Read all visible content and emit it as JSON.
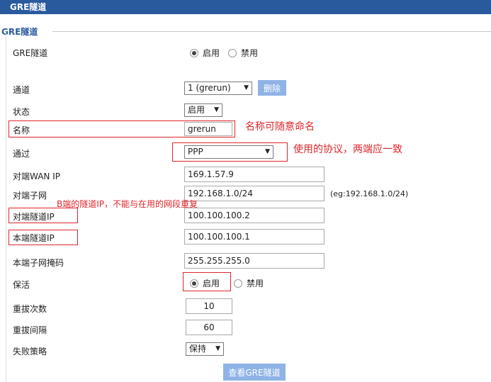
{
  "window": {
    "title": "GRE隧道"
  },
  "section": {
    "title": "GRE隧道"
  },
  "form": {
    "gre_tunnel": {
      "label": "GRE隧道",
      "enable": "启用",
      "disable": "禁用"
    },
    "channel": {
      "label": "通道",
      "value": "1 (grerun)",
      "delete_label": "删除"
    },
    "status": {
      "label": "状态",
      "value": "启用"
    },
    "name": {
      "label": "名称",
      "value": "grerun"
    },
    "via": {
      "label": "通过",
      "value": "PPP"
    },
    "remote_wan_ip": {
      "label": "对端WAN IP",
      "value": "169.1.57.9"
    },
    "remote_subnet": {
      "label": "对端子网",
      "value": "192.168.1.0/24",
      "hint": "(eg:192.168.1.0/24)"
    },
    "remote_tunnel_ip": {
      "label": "对端隧道IP",
      "value": "100.100.100.2"
    },
    "local_tunnel_ip": {
      "label": "本端隧道IP",
      "value": "100.100.100.1"
    },
    "local_subnet_mask": {
      "label": "本端子网掩码",
      "value": "255.255.255.0"
    },
    "keepalive": {
      "label": "保活",
      "enable": "启用",
      "disable": "禁用"
    },
    "redial_count": {
      "label": "重拔次数",
      "value": "10"
    },
    "redial_interval": {
      "label": "重拔间隔",
      "value": "60"
    },
    "failure_policy": {
      "label": "失败策略",
      "value": "保持"
    },
    "view_button": "查看GRE隧道"
  },
  "annotations": {
    "name_note": "名称可随意命名",
    "protocol_note": "使用的协议，两端应一致",
    "tunnel_ip_note": "B端的隧道IP，不能与在用的网段重复"
  },
  "icons": {
    "dropdown": "caret-down-icon",
    "radio": "radio-icon"
  },
  "colors": {
    "titlebar": "#2a5a9e",
    "button": "#8fb3e6",
    "annotation": "#e0252b"
  }
}
